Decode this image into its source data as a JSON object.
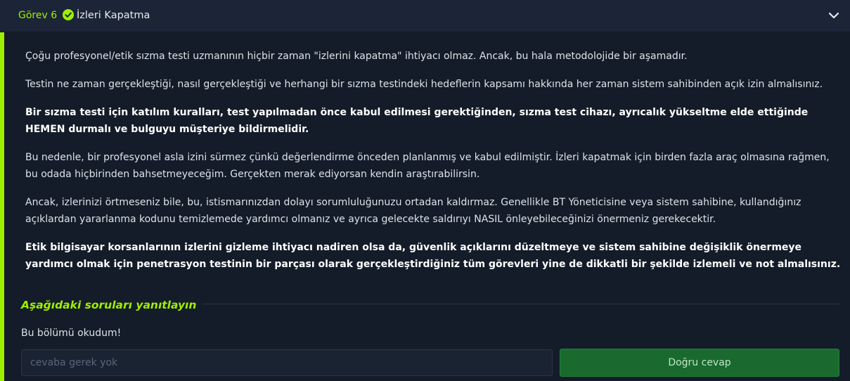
{
  "task": {
    "number_label": "Görev 6",
    "title": "İzleri Kapatma",
    "status_icon": "check-circle-icon",
    "toggle_icon": "chevron-down-icon"
  },
  "colors": {
    "accent": "#9fef00",
    "header_bg": "#1c2538",
    "body_bg": "#141c29",
    "button_bg": "#1a6a2f"
  },
  "paragraphs": [
    {
      "text": "Çoğu profesyonel/etik sızma testi uzmanının hiçbir zaman \"izlerini kapatma\" ihtiyacı olmaz. Ancak, bu hala metodolojide bir aşamadır.",
      "bold": false
    },
    {
      "text": "Testin ne zaman gerçekleştiği, nasıl gerçekleştiği ve herhangi bir sızma testindeki hedeflerin kapsamı hakkında her zaman sistem sahibinden açık izin almalısınız.",
      "bold": false
    },
    {
      "text": "Bir sızma testi için katılım kuralları, test yapılmadan önce kabul edilmesi gerektiğinden, sızma test cihazı, ayrıcalık yükseltme elde ettiğinde HEMEN durmalı ve bulguyu müşteriye bildirmelidir.",
      "bold": true
    },
    {
      "text": "Bu nedenle, bir profesyonel asla izini sürmez çünkü değerlendirme önceden planlanmış ve kabul edilmiştir. İzleri kapatmak için birden fazla araç olmasına rağmen, bu odada hiçbirinden bahsetmeyeceğim. Gerçekten merak ediyorsan kendin araştırabilirsin.",
      "bold": false
    },
    {
      "text": "Ancak, izlerinizi örtmeseniz bile, bu, istismarınızdan dolayı sorumluluğunuzu ortadan kaldırmaz. Genellikle BT Yöneticisine veya sistem sahibine, kullandığınız açıklardan yararlanma kodunu temizlemede yardımcı olmanız ve ayrıca gelecekte saldırıyı NASIL önleyebileceğinizi önermeniz gerekecektir.",
      "bold": false
    },
    {
      "text": "Etik bilgisayar korsanlarının izlerini gizleme ihtiyacı nadiren olsa da, güvenlik açıklarını düzeltmeye ve sistem sahibine değişiklik önermeye yardımcı olmak için penetrasyon testinin bir parçası olarak gerçekleştirdiğiniz tüm görevleri yine de dikkatli bir şekilde izlemeli ve not almalısınız.",
      "bold": true
    }
  ],
  "questions": {
    "heading": "Aşağıdaki soruları yanıtlayın",
    "items": [
      {
        "text": "Bu bölümü okudum!",
        "input_value": "",
        "input_placeholder": "cevaba gerek yok",
        "submit_label": "Doğru cevap"
      }
    ]
  }
}
